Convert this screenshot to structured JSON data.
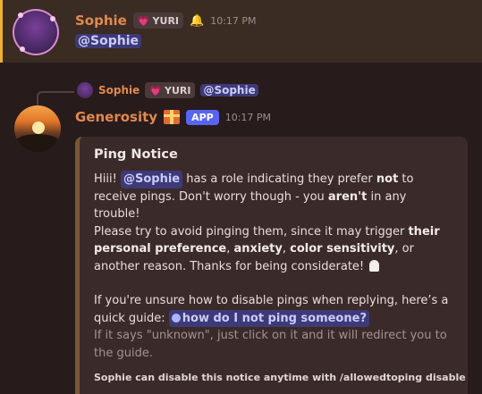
{
  "message1": {
    "author": "Sophie",
    "tag_heart": "💗",
    "tag_text": "YURI",
    "bell": "🔔",
    "time": "10:17 PM",
    "content_mention": "@Sophie"
  },
  "reply": {
    "author": "Sophie",
    "tag_heart": "💗",
    "tag_text": "YURI",
    "mention": "@Sophie"
  },
  "message2": {
    "author": "Generosity",
    "app_badge": "APP",
    "time": "10:17 PM"
  },
  "embed": {
    "title": "Ping Notice",
    "p1_a": "Hiii! ",
    "p1_mention": "@Sophie",
    "p1_b": " has a role indicating they prefer ",
    "p1_not": "not",
    "p1_c": " to receive pings. Don't worry though - you ",
    "p1_arent": "aren't",
    "p1_d": " in any trouble!",
    "p2_a": "Please try to avoid pinging them, since it may trigger ",
    "p2_their": "their personal preference",
    "p2_b": ", ",
    "p2_anxiety": "anxiety",
    "p2_c": ", ",
    "p2_color": "color sensitivity",
    "p2_d": ", or another reason. Thanks for being considerate!",
    "p3_a": "If you're unsure how to disable pings when replying, here’s a quick guide: ",
    "p3_link": "how do I not ping someone?",
    "p4": "If it says \"unknown\", just click on it and it will redirect you to the guide.",
    "footer": "Sophie can disable this notice anytime with /allowedtoping disable"
  },
  "colors": {
    "accent_bar": "#f0b232",
    "author_name": "#e08a4e",
    "mention_bg": "#3e3a78",
    "app_badge": "#5865f2",
    "embed_border": "#7a5736"
  }
}
